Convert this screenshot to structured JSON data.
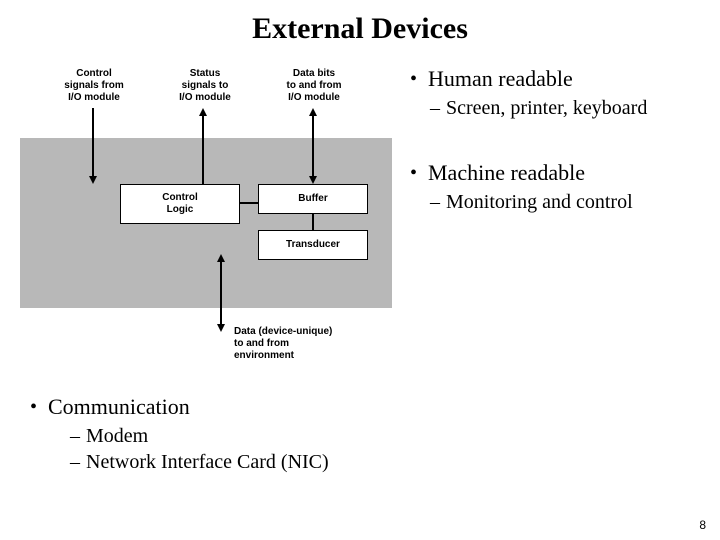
{
  "title": "External Devices",
  "diagram": {
    "top_labels": {
      "control": "Control\nsignals from\nI/O module",
      "status": "Status\nsignals to\nI/O module",
      "data": "Data bits\nto and from\nI/O module"
    },
    "boxes": {
      "control_logic": "Control\nLogic",
      "buffer": "Buffer",
      "transducer": "Transducer"
    },
    "bottom_label": "Data (device-unique)\nto and from\nenvironment"
  },
  "bullets": {
    "human": "Human readable",
    "human_sub": "Screen, printer, keyboard",
    "machine": "Machine readable",
    "machine_sub": "Monitoring and control",
    "comm": "Communication",
    "comm_sub1": "Modem",
    "comm_sub2": "Network Interface Card (NIC)"
  },
  "page_number": "8"
}
